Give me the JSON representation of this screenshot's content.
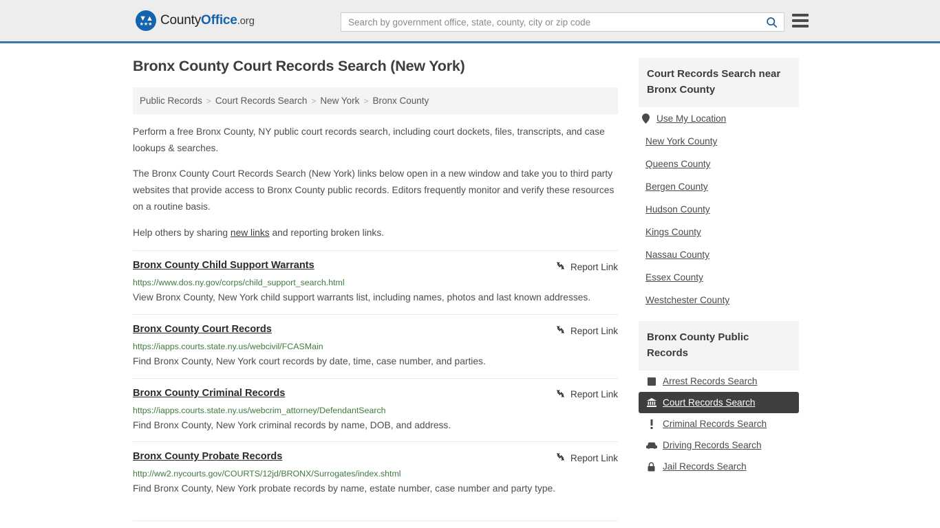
{
  "header": {
    "logo": {
      "text_1": "County",
      "text_2": "Office",
      "text_3": ".org",
      "mark_icon": "eagle-seal-icon"
    },
    "search": {
      "placeholder": "Search by government office, state, county, city or zip code",
      "value": "",
      "button_icon": "search-icon"
    },
    "menu_icon": "hamburger-menu-icon"
  },
  "page_title": "Bronx County Court Records Search (New York)",
  "breadcrumb": [
    "Public Records",
    "Court Records Search",
    "New York",
    "Bronx County"
  ],
  "breadcrumb_separator": ">",
  "intro": {
    "p1": "Perform a free Bronx County, NY public court records search, including court dockets, files, transcripts, and case lookups & searches.",
    "p2": "The Bronx County Court Records Search (New York) links below open in a new window and take you to third party websites that provide access to Bronx County public records. Editors frequently monitor and verify these resources on a routine basis.",
    "p3_before": "Help others by sharing ",
    "p3_link": "new links",
    "p3_after": " and reporting broken links."
  },
  "report_link_label": "Report Link",
  "report_link_icon": "broken-link-icon",
  "results": [
    {
      "title": "Bronx County Child Support Warrants",
      "url": "https://www.dos.ny.gov/corps/child_support_search.html",
      "description": "View Bronx County, New York child support warrants list, including names, photos and last known addresses."
    },
    {
      "title": "Bronx County Court Records",
      "url": "https://iapps.courts.state.ny.us/webcivil/FCASMain",
      "description": "Find Bronx County, New York court records by date, time, case number, and parties."
    },
    {
      "title": "Bronx County Criminal Records",
      "url": "https://iapps.courts.state.ny.us/webcrim_attorney/DefendantSearch",
      "description": "Find Bronx County, New York criminal records by name, DOB, and address."
    },
    {
      "title": "Bronx County Probate Records",
      "url": "http://ww2.nycourts.gov/COURTS/12jd/BRONX/Surrogates/index.shtml",
      "description": "Find Bronx County, New York probate records by name, estate number, case number and party type."
    }
  ],
  "sidebar": {
    "nearby": {
      "title": "Court Records Search near Bronx County",
      "use_my_location": {
        "label": "Use My Location",
        "icon": "map-pin-icon"
      },
      "counties": [
        "New York County",
        "Queens County",
        "Bergen County",
        "Hudson County",
        "Kings County",
        "Nassau County",
        "Essex County",
        "Westchester County"
      ]
    },
    "public_records": {
      "title": "Bronx County Public Records",
      "items": [
        {
          "label": "Arrest Records Search",
          "icon": "fingerprint-square-icon",
          "active": false
        },
        {
          "label": "Court Records Search",
          "icon": "courthouse-icon",
          "active": true
        },
        {
          "label": "Criminal Records Search",
          "icon": "exclamation-icon",
          "active": false
        },
        {
          "label": "Driving Records Search",
          "icon": "car-icon",
          "active": false
        },
        {
          "label": "Jail Records Search",
          "icon": "lock-icon",
          "active": false
        }
      ]
    }
  },
  "colors": {
    "brand_blue": "#1464ad",
    "header_border": "#3a77ad",
    "url_green": "#3f7a3f",
    "active_bg": "#3f3f3f"
  }
}
